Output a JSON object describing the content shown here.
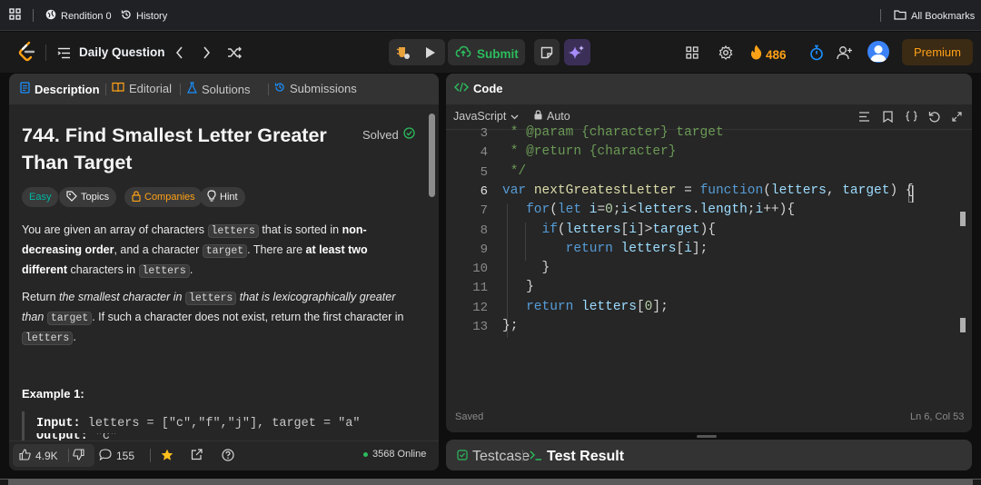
{
  "browser": {
    "rendition": "Rendition 0",
    "history": "History",
    "all_bookmarks": "All Bookmarks"
  },
  "nav": {
    "title": "Daily Question",
    "submit": "Submit",
    "streak": "486",
    "premium": "Premium"
  },
  "left_tabs": [
    "Description",
    "Editorial",
    "Solutions",
    "Submissions"
  ],
  "problem": {
    "title": "744. Find Smallest Letter Greater Than Target",
    "status": "Solved",
    "tags": {
      "difficulty": "Easy",
      "topics": "Topics",
      "companies": "Companies",
      "hint": "Hint"
    },
    "p1": [
      {
        "t": "You are given an array of characters "
      },
      {
        "c": "letters"
      },
      {
        "t": " that is sorted in "
      },
      {
        "b": "non-decreasing order"
      },
      {
        "t": ", and a character "
      },
      {
        "c": "target"
      },
      {
        "t": ". There are "
      },
      {
        "b": "at least two different"
      },
      {
        "t": " characters in "
      },
      {
        "c": "letters"
      },
      {
        "t": "."
      }
    ],
    "p2": [
      {
        "t": "Return "
      },
      {
        "i": "the smallest character in "
      },
      {
        "c": "letters"
      },
      {
        "i": " that is lexicographically greater than "
      },
      {
        "c": "target"
      },
      {
        "t": ". If such a character does not exist, return the first character in "
      },
      {
        "c": "letters"
      },
      {
        "t": "."
      }
    ],
    "example_title": "Example 1:",
    "example_input_label": "Input:",
    "example_input": "letters = [\"c\",\"f\",\"j\"], target = \"a\"",
    "example_output_label": "Output:",
    "example_output": "\"c\""
  },
  "left_footer": {
    "likes": "4.9K",
    "comments": "155",
    "online": "3568 Online"
  },
  "code_panel": {
    "title": "Code",
    "language": "JavaScript",
    "mode": "Auto",
    "saved": "Saved",
    "cursor": "Ln 6, Col 53",
    "line_numbers": [
      "3",
      "4",
      "5",
      "6",
      "7",
      "8",
      "9",
      "10",
      "11",
      "12",
      "13"
    ],
    "lines": [
      " * @param {character} target",
      " * @return {character}",
      " */",
      "var nextGreatestLetter = function(letters, target) {",
      "   for(let i=0;i<letters.length;i++){",
      "     if(letters[i]>target){",
      "        return letters[i];",
      "     }",
      "   }",
      "   return letters[0];",
      "};"
    ]
  },
  "bottom_tabs": {
    "testcase": "Testcase",
    "test_result": "Test Result"
  },
  "colors": {
    "accent_green": "#2cbb5d",
    "easy": "#00b8a3",
    "orange": "#ffa116",
    "link_blue": "#1a90ff"
  }
}
